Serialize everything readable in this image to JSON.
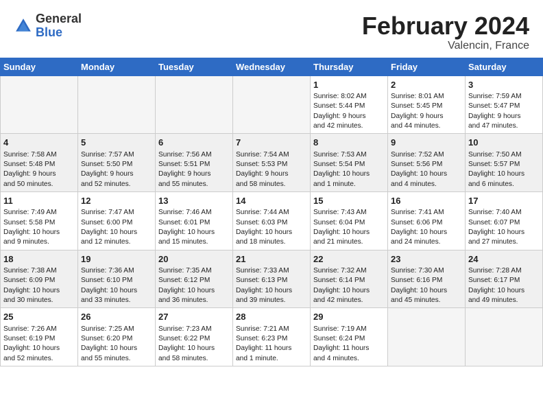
{
  "header": {
    "logo_general": "General",
    "logo_blue": "Blue",
    "month_title": "February 2024",
    "location": "Valencin, France"
  },
  "days_of_week": [
    "Sunday",
    "Monday",
    "Tuesday",
    "Wednesday",
    "Thursday",
    "Friday",
    "Saturday"
  ],
  "weeks": [
    {
      "shade": "white",
      "days": [
        {
          "num": "",
          "info": ""
        },
        {
          "num": "",
          "info": ""
        },
        {
          "num": "",
          "info": ""
        },
        {
          "num": "",
          "info": ""
        },
        {
          "num": "1",
          "info": "Sunrise: 8:02 AM\nSunset: 5:44 PM\nDaylight: 9 hours\nand 42 minutes."
        },
        {
          "num": "2",
          "info": "Sunrise: 8:01 AM\nSunset: 5:45 PM\nDaylight: 9 hours\nand 44 minutes."
        },
        {
          "num": "3",
          "info": "Sunrise: 7:59 AM\nSunset: 5:47 PM\nDaylight: 9 hours\nand 47 minutes."
        }
      ]
    },
    {
      "shade": "shaded",
      "days": [
        {
          "num": "4",
          "info": "Sunrise: 7:58 AM\nSunset: 5:48 PM\nDaylight: 9 hours\nand 50 minutes."
        },
        {
          "num": "5",
          "info": "Sunrise: 7:57 AM\nSunset: 5:50 PM\nDaylight: 9 hours\nand 52 minutes."
        },
        {
          "num": "6",
          "info": "Sunrise: 7:56 AM\nSunset: 5:51 PM\nDaylight: 9 hours\nand 55 minutes."
        },
        {
          "num": "7",
          "info": "Sunrise: 7:54 AM\nSunset: 5:53 PM\nDaylight: 9 hours\nand 58 minutes."
        },
        {
          "num": "8",
          "info": "Sunrise: 7:53 AM\nSunset: 5:54 PM\nDaylight: 10 hours\nand 1 minute."
        },
        {
          "num": "9",
          "info": "Sunrise: 7:52 AM\nSunset: 5:56 PM\nDaylight: 10 hours\nand 4 minutes."
        },
        {
          "num": "10",
          "info": "Sunrise: 7:50 AM\nSunset: 5:57 PM\nDaylight: 10 hours\nand 6 minutes."
        }
      ]
    },
    {
      "shade": "white",
      "days": [
        {
          "num": "11",
          "info": "Sunrise: 7:49 AM\nSunset: 5:58 PM\nDaylight: 10 hours\nand 9 minutes."
        },
        {
          "num": "12",
          "info": "Sunrise: 7:47 AM\nSunset: 6:00 PM\nDaylight: 10 hours\nand 12 minutes."
        },
        {
          "num": "13",
          "info": "Sunrise: 7:46 AM\nSunset: 6:01 PM\nDaylight: 10 hours\nand 15 minutes."
        },
        {
          "num": "14",
          "info": "Sunrise: 7:44 AM\nSunset: 6:03 PM\nDaylight: 10 hours\nand 18 minutes."
        },
        {
          "num": "15",
          "info": "Sunrise: 7:43 AM\nSunset: 6:04 PM\nDaylight: 10 hours\nand 21 minutes."
        },
        {
          "num": "16",
          "info": "Sunrise: 7:41 AM\nSunset: 6:06 PM\nDaylight: 10 hours\nand 24 minutes."
        },
        {
          "num": "17",
          "info": "Sunrise: 7:40 AM\nSunset: 6:07 PM\nDaylight: 10 hours\nand 27 minutes."
        }
      ]
    },
    {
      "shade": "shaded",
      "days": [
        {
          "num": "18",
          "info": "Sunrise: 7:38 AM\nSunset: 6:09 PM\nDaylight: 10 hours\nand 30 minutes."
        },
        {
          "num": "19",
          "info": "Sunrise: 7:36 AM\nSunset: 6:10 PM\nDaylight: 10 hours\nand 33 minutes."
        },
        {
          "num": "20",
          "info": "Sunrise: 7:35 AM\nSunset: 6:12 PM\nDaylight: 10 hours\nand 36 minutes."
        },
        {
          "num": "21",
          "info": "Sunrise: 7:33 AM\nSunset: 6:13 PM\nDaylight: 10 hours\nand 39 minutes."
        },
        {
          "num": "22",
          "info": "Sunrise: 7:32 AM\nSunset: 6:14 PM\nDaylight: 10 hours\nand 42 minutes."
        },
        {
          "num": "23",
          "info": "Sunrise: 7:30 AM\nSunset: 6:16 PM\nDaylight: 10 hours\nand 45 minutes."
        },
        {
          "num": "24",
          "info": "Sunrise: 7:28 AM\nSunset: 6:17 PM\nDaylight: 10 hours\nand 49 minutes."
        }
      ]
    },
    {
      "shade": "white",
      "days": [
        {
          "num": "25",
          "info": "Sunrise: 7:26 AM\nSunset: 6:19 PM\nDaylight: 10 hours\nand 52 minutes."
        },
        {
          "num": "26",
          "info": "Sunrise: 7:25 AM\nSunset: 6:20 PM\nDaylight: 10 hours\nand 55 minutes."
        },
        {
          "num": "27",
          "info": "Sunrise: 7:23 AM\nSunset: 6:22 PM\nDaylight: 10 hours\nand 58 minutes."
        },
        {
          "num": "28",
          "info": "Sunrise: 7:21 AM\nSunset: 6:23 PM\nDaylight: 11 hours\nand 1 minute."
        },
        {
          "num": "29",
          "info": "Sunrise: 7:19 AM\nSunset: 6:24 PM\nDaylight: 11 hours\nand 4 minutes."
        },
        {
          "num": "",
          "info": ""
        },
        {
          "num": "",
          "info": ""
        }
      ]
    }
  ]
}
